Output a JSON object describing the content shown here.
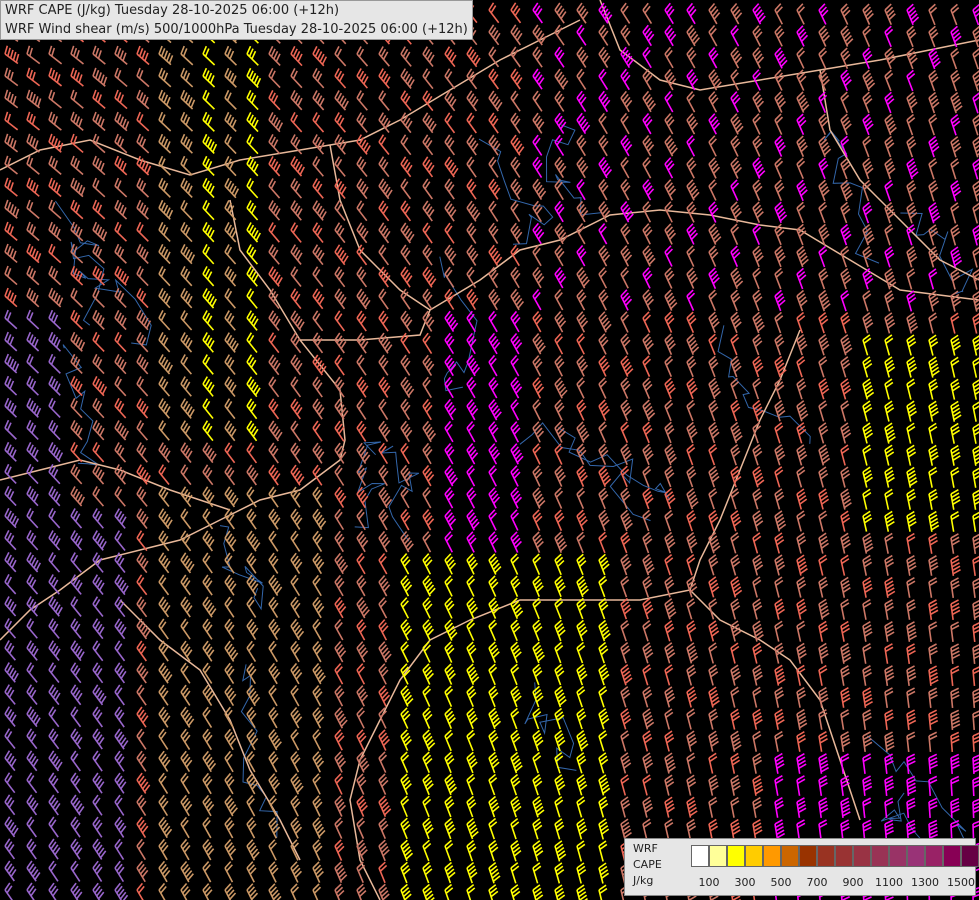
{
  "title": {
    "line1": "WRF CAPE (J/kg) Tuesday 28-10-2025 06:00 (+12h)",
    "line2": "WRF Wind shear (m/s) 500/1000hPa Tuesday 28-10-2025 06:00 (+12h)"
  },
  "legend": {
    "label_model": "WRF",
    "label_field": "CAPE",
    "label_unit": "J/kg",
    "colors": [
      "#ffffff",
      "#ffff99",
      "#ffff00",
      "#ffcc00",
      "#ff9900",
      "#cc6600",
      "#993300",
      "#993322",
      "#993333",
      "#993344",
      "#993355",
      "#993366",
      "#993377",
      "#992266",
      "#880055",
      "#660044"
    ],
    "tick_labels": [
      "100",
      "300",
      "500",
      "700",
      "900",
      "1100",
      "1300",
      "1500"
    ]
  },
  "wind_barb_colors": {
    "weak": "#9966cc",
    "light": "#cc9966",
    "moderate": "#cc7766",
    "strong": "#ee6655",
    "very_strong": "#ffff00",
    "extreme": "#ff00ff"
  },
  "map_colors": {
    "background": "#000000",
    "border": "#e8b89a",
    "river": "#3366aa"
  }
}
